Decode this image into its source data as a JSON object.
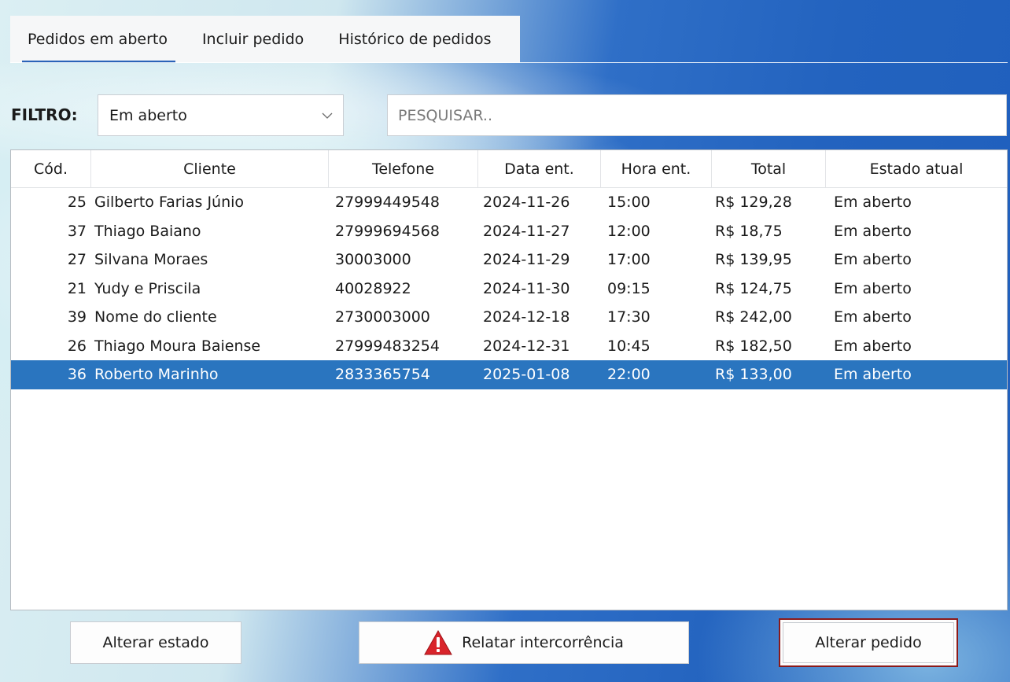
{
  "tabs": [
    {
      "label": "Pedidos em aberto",
      "active": true
    },
    {
      "label": "Incluir pedido",
      "active": false
    },
    {
      "label": "Histórico de pedidos",
      "active": false
    }
  ],
  "filter": {
    "label": "FILTRO:",
    "selected": "Em aberto",
    "search_placeholder": "PESQUISAR.."
  },
  "table": {
    "columns": [
      "Cód.",
      "Cliente",
      "Telefone",
      "Data ent.",
      "Hora ent.",
      "Total",
      "Estado atual"
    ],
    "rows": [
      {
        "cod": "25",
        "cliente": "Gilberto Farias Júnio",
        "telefone": "27999449548",
        "data": "2024-11-26",
        "hora": "15:00",
        "total": "R$ 129,28",
        "estado": "Em aberto"
      },
      {
        "cod": "37",
        "cliente": "Thiago Baiano",
        "telefone": "27999694568",
        "data": "2024-11-27",
        "hora": "12:00",
        "total": "R$ 18,75",
        "estado": "Em aberto"
      },
      {
        "cod": "27",
        "cliente": "Silvana Moraes",
        "telefone": "30003000",
        "data": "2024-11-29",
        "hora": "17:00",
        "total": "R$ 139,95",
        "estado": "Em aberto"
      },
      {
        "cod": "21",
        "cliente": "Yudy e Priscila",
        "telefone": "40028922",
        "data": "2024-11-30",
        "hora": "09:15",
        "total": "R$ 124,75",
        "estado": "Em aberto"
      },
      {
        "cod": "39",
        "cliente": "Nome do cliente",
        "telefone": "2730003000",
        "data": "2024-12-18",
        "hora": "17:30",
        "total": "R$ 242,00",
        "estado": "Em aberto"
      },
      {
        "cod": "26",
        "cliente": "Thiago Moura Baiense",
        "telefone": "27999483254",
        "data": "2024-12-31",
        "hora": "10:45",
        "total": "R$ 182,50",
        "estado": "Em aberto"
      },
      {
        "cod": "36",
        "cliente": "Roberto Marinho",
        "telefone": "2833365754",
        "data": "2025-01-08",
        "hora": "22:00",
        "total": "R$ 133,00",
        "estado": "Em aberto",
        "selected": true
      }
    ]
  },
  "buttons": {
    "alterar_estado": "Alterar estado",
    "relatar": "Relatar intercorrência",
    "alterar_pedido": "Alterar pedido"
  },
  "icons": {
    "warning": "warning-triangle-icon",
    "dropdown": "chevron-down-icon"
  },
  "colors": {
    "selection": "#2a75bf",
    "tab_underline": "#2a63b8",
    "focus_border": "#8b1a1a",
    "warning_red": "#d9242b"
  }
}
